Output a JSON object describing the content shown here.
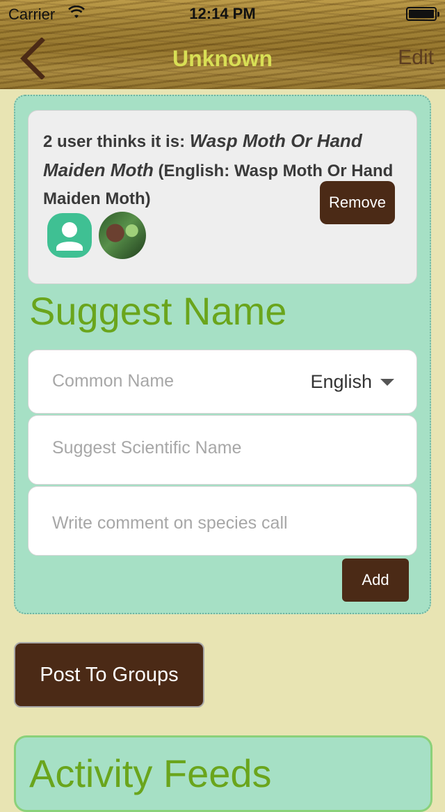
{
  "status_bar": {
    "carrier": "Carrier",
    "time": "12:14 PM"
  },
  "nav": {
    "title": "Unknown",
    "edit_label": "Edit",
    "back_icon": "chevron-left-icon"
  },
  "suggestion": {
    "prefix": "2 user thinks it is: ",
    "species": "Wasp Moth Or Hand Maiden Moth",
    "suffix": " (English: Wasp Moth Or Hand Maiden Moth)",
    "remove_label": "Remove"
  },
  "suggest_name": {
    "heading": "Suggest Name",
    "common_name_placeholder": "Common Name",
    "language_value": "English",
    "scientific_placeholder": "Suggest Scientific Name",
    "comment_placeholder": "Write comment on species call",
    "add_label": "Add"
  },
  "post_to_groups_label": "Post To Groups",
  "activity_heading": "Activity Feeds",
  "colors": {
    "accent_green": "#6aa51c",
    "button_brown": "#4b2a16",
    "panel_teal": "#a6e0c5",
    "background": "#e8e4b3"
  }
}
